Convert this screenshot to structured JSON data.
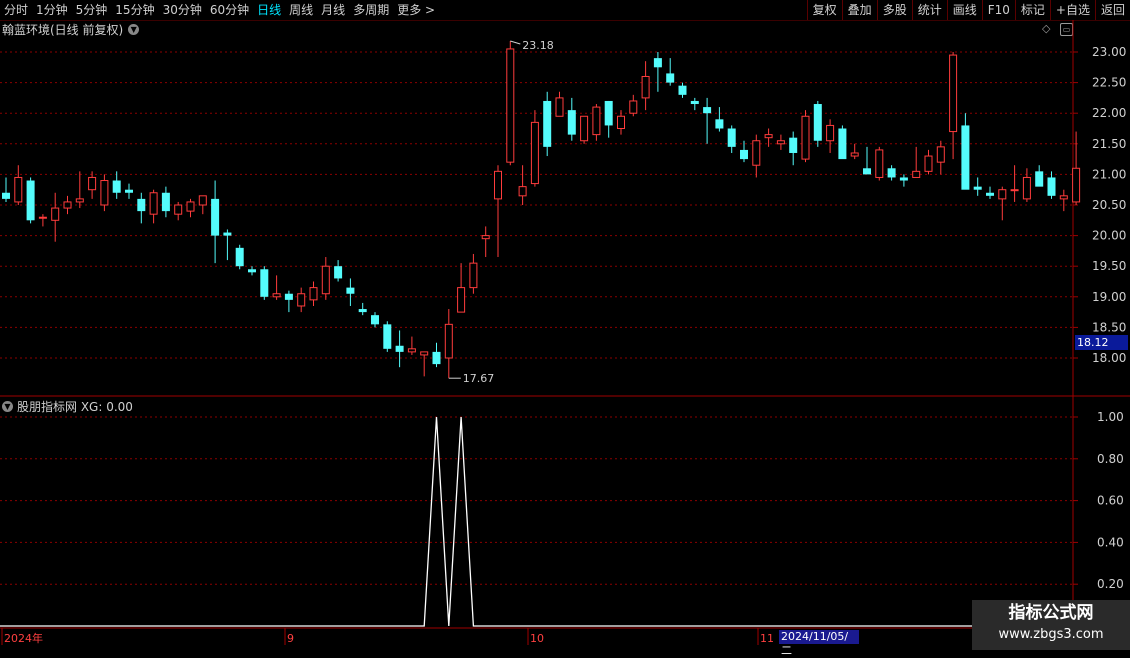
{
  "toolbar": {
    "periods": [
      "分时",
      "1分钟",
      "5分钟",
      "15分钟",
      "30分钟",
      "60分钟",
      "日线",
      "周线",
      "月线",
      "多周期",
      "更多 >"
    ],
    "active_period": "日线",
    "buttons": [
      "复权",
      "叠加",
      "多股",
      "统计",
      "画线",
      "F10",
      "标记",
      "+自选",
      "返回"
    ]
  },
  "chart_title": "翰蓝环境(日线 前复权)",
  "indicator_title": "股朋指标网 XG: 0.00",
  "price_axis": [
    "23.00",
    "22.50",
    "22.00",
    "21.50",
    "21.00",
    "20.50",
    "20.00",
    "19.50",
    "19.00",
    "18.50",
    "18.00"
  ],
  "current_price": "18.12",
  "indicator_axis": [
    "1.00",
    "0.80",
    "0.60",
    "0.40",
    "0.20"
  ],
  "annotations": {
    "high": "23.18",
    "low": "17.67"
  },
  "time_axis": [
    "2024年",
    "9",
    "10",
    "11"
  ],
  "selected_date": "2024/11/05/二",
  "watermark": {
    "line1": "指标公式网",
    "line2": "www.zbgs3.com"
  },
  "colors": {
    "up": "#ff3c3c",
    "down": "#54fcfc",
    "grid": "#8b0000",
    "axis": "#a00000"
  },
  "chart_data": {
    "type": "candlestick",
    "ylim": [
      17.5,
      23.3
    ],
    "candles": [
      [
        20.7,
        20.95,
        20.55,
        20.6
      ],
      [
        20.55,
        21.15,
        20.5,
        20.95
      ],
      [
        20.9,
        20.95,
        20.2,
        20.25
      ],
      [
        20.3,
        20.35,
        20.15,
        20.3
      ],
      [
        20.25,
        20.7,
        19.9,
        20.45
      ],
      [
        20.45,
        20.65,
        20.35,
        20.55
      ],
      [
        20.55,
        21.05,
        20.45,
        20.6
      ],
      [
        20.75,
        21.05,
        20.6,
        20.95
      ],
      [
        20.5,
        21.0,
        20.4,
        20.9
      ],
      [
        20.9,
        21.05,
        20.6,
        20.7
      ],
      [
        20.75,
        20.85,
        20.6,
        20.7
      ],
      [
        20.6,
        20.7,
        20.2,
        20.4
      ],
      [
        20.35,
        20.75,
        20.2,
        20.7
      ],
      [
        20.7,
        20.8,
        20.3,
        20.4
      ],
      [
        20.35,
        20.55,
        20.25,
        20.5
      ],
      [
        20.4,
        20.6,
        20.3,
        20.55
      ],
      [
        20.5,
        20.65,
        20.35,
        20.65
      ],
      [
        20.6,
        20.9,
        19.55,
        20.0
      ],
      [
        20.05,
        20.1,
        19.6,
        20.0
      ],
      [
        19.8,
        19.85,
        19.45,
        19.5
      ],
      [
        19.45,
        19.5,
        19.35,
        19.4
      ],
      [
        19.45,
        19.5,
        18.95,
        19.0
      ],
      [
        19.0,
        19.35,
        18.95,
        19.05
      ],
      [
        19.05,
        19.1,
        18.75,
        18.95
      ],
      [
        18.85,
        19.15,
        18.75,
        19.05
      ],
      [
        18.95,
        19.25,
        18.85,
        19.15
      ],
      [
        19.05,
        19.65,
        18.95,
        19.5
      ],
      [
        19.5,
        19.6,
        19.25,
        19.3
      ],
      [
        19.15,
        19.3,
        18.85,
        19.05
      ],
      [
        18.8,
        18.9,
        18.7,
        18.75
      ],
      [
        18.7,
        18.75,
        18.5,
        18.55
      ],
      [
        18.55,
        18.6,
        18.1,
        18.15
      ],
      [
        18.2,
        18.45,
        17.85,
        18.1
      ],
      [
        18.1,
        18.35,
        18.05,
        18.15
      ],
      [
        18.05,
        18.1,
        17.7,
        18.1
      ],
      [
        18.1,
        18.25,
        17.85,
        17.9
      ],
      [
        18.0,
        18.8,
        17.67,
        18.55
      ],
      [
        18.75,
        19.55,
        18.75,
        19.15
      ],
      [
        19.15,
        19.7,
        19.05,
        19.55
      ],
      [
        19.95,
        20.15,
        19.65,
        20.0
      ],
      [
        20.6,
        21.15,
        19.65,
        21.05
      ],
      [
        21.2,
        23.18,
        21.15,
        23.05
      ],
      [
        20.65,
        21.15,
        20.5,
        20.8
      ],
      [
        20.85,
        22.05,
        20.8,
        21.85
      ],
      [
        22.2,
        22.35,
        21.3,
        21.45
      ],
      [
        21.95,
        22.35,
        21.95,
        22.25
      ],
      [
        22.05,
        22.25,
        21.55,
        21.65
      ],
      [
        21.55,
        21.85,
        21.5,
        21.95
      ],
      [
        21.65,
        22.15,
        21.55,
        22.1
      ],
      [
        22.2,
        22.2,
        21.6,
        21.8
      ],
      [
        21.75,
        22.05,
        21.65,
        21.95
      ],
      [
        22.0,
        22.3,
        21.95,
        22.2
      ],
      [
        22.25,
        22.85,
        22.05,
        22.6
      ],
      [
        22.9,
        23.0,
        22.35,
        22.75
      ],
      [
        22.65,
        22.9,
        22.45,
        22.5
      ],
      [
        22.45,
        22.5,
        22.25,
        22.3
      ],
      [
        22.2,
        22.25,
        22.05,
        22.15
      ],
      [
        22.1,
        22.25,
        21.5,
        22.0
      ],
      [
        21.9,
        22.1,
        21.7,
        21.75
      ],
      [
        21.75,
        21.8,
        21.35,
        21.45
      ],
      [
        21.4,
        21.55,
        21.2,
        21.25
      ],
      [
        21.15,
        21.65,
        20.95,
        21.55
      ],
      [
        21.6,
        21.75,
        21.45,
        21.65
      ],
      [
        21.5,
        21.65,
        21.4,
        21.55
      ],
      [
        21.6,
        21.7,
        21.15,
        21.35
      ],
      [
        21.25,
        22.05,
        21.2,
        21.95
      ],
      [
        22.15,
        22.2,
        21.45,
        21.55
      ],
      [
        21.55,
        21.9,
        21.35,
        21.8
      ],
      [
        21.75,
        21.8,
        21.3,
        21.25
      ],
      [
        21.3,
        21.5,
        21.25,
        21.35
      ],
      [
        21.1,
        21.45,
        21.05,
        21.0
      ],
      [
        20.95,
        21.45,
        20.9,
        21.4
      ],
      [
        21.1,
        21.15,
        20.9,
        20.95
      ],
      [
        20.95,
        21.0,
        20.8,
        20.9
      ],
      [
        20.95,
        21.45,
        20.95,
        21.05
      ],
      [
        21.05,
        21.4,
        21.0,
        21.3
      ],
      [
        21.2,
        21.55,
        21.0,
        21.45
      ],
      [
        21.7,
        23.0,
        21.25,
        22.95
      ],
      [
        21.8,
        22.0,
        20.8,
        20.75
      ],
      [
        20.8,
        20.95,
        20.65,
        20.75
      ],
      [
        20.7,
        20.8,
        20.6,
        20.65
      ],
      [
        20.6,
        20.8,
        20.25,
        20.75
      ],
      [
        20.75,
        21.15,
        20.55,
        20.75
      ],
      [
        20.6,
        21.1,
        20.55,
        20.95
      ],
      [
        21.05,
        21.15,
        20.85,
        20.8
      ],
      [
        20.95,
        21.05,
        20.6,
        20.65
      ],
      [
        20.6,
        20.75,
        20.4,
        20.65
      ],
      [
        20.55,
        21.7,
        20.5,
        21.1
      ]
    ],
    "xg_signal": [
      0,
      0,
      0,
      0,
      0,
      0,
      0,
      0,
      0,
      0,
      0,
      0,
      0,
      0,
      0,
      0,
      0,
      0,
      0,
      0,
      0,
      0,
      0,
      0,
      0,
      0,
      0,
      0,
      0,
      0,
      0,
      0,
      0,
      0,
      0,
      1,
      0,
      1,
      0,
      0,
      0,
      0,
      0,
      0,
      0,
      0,
      0,
      0,
      0,
      0,
      0,
      0,
      0,
      0,
      0,
      0,
      0,
      0,
      0,
      0,
      0,
      0,
      0,
      0,
      0,
      0,
      0,
      0,
      0,
      0,
      0,
      0,
      0,
      0,
      0,
      0,
      0,
      0,
      0,
      0,
      0,
      0,
      0,
      0,
      0,
      0,
      0
    ]
  }
}
